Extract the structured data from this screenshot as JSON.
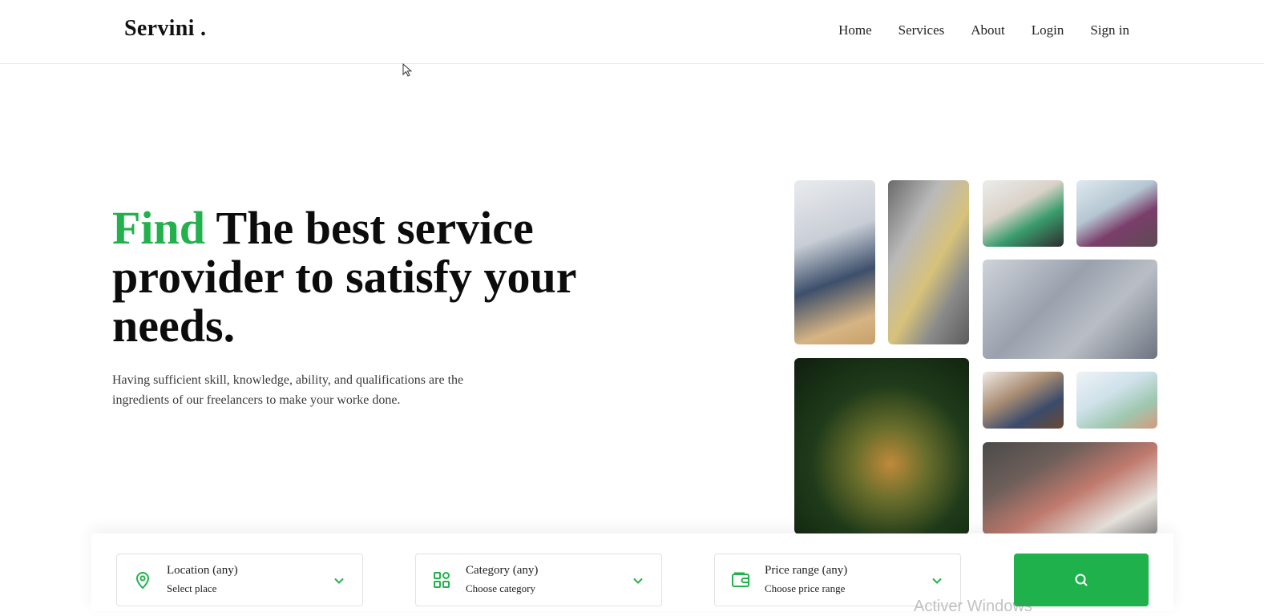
{
  "header": {
    "logo": "Servini .",
    "nav": [
      "Home",
      "Services",
      "About",
      "Login",
      "Sign in"
    ]
  },
  "hero": {
    "title_accent": "Find",
    "title_rest": " The best service provider to satisfy your needs.",
    "description": "Having sufficient skill, knowledge, ability, and qualifications are the ingredients of our freelancers to make your worke done."
  },
  "search": {
    "location": {
      "label": "Location (any)",
      "sub": "Select place",
      "icon": "map-pin-icon"
    },
    "category": {
      "label": "Category (any)",
      "sub": "Choose category",
      "icon": "grid-icon"
    },
    "price": {
      "label": "Price range (any)",
      "sub": "Choose price range",
      "icon": "wallet-icon"
    },
    "button_icon": "search-icon"
  },
  "watermark": "Activer Windows",
  "colors": {
    "accent": "#22b14c",
    "button": "#1fb24c"
  }
}
